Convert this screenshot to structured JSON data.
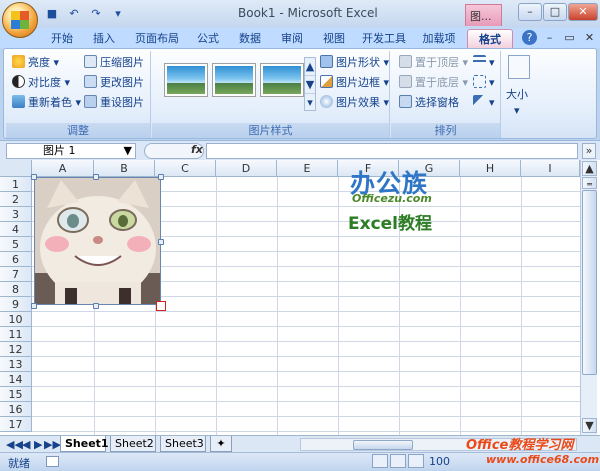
{
  "window": {
    "title": "Book1 - Microsoft Excel",
    "context_title": "图...",
    "controls": [
      "–",
      "□",
      "✕"
    ]
  },
  "qat": [
    "save-icon",
    "undo-icon",
    "redo-icon",
    "customize-icon"
  ],
  "tabs": [
    "开始",
    "插入",
    "页面布局",
    "公式",
    "数据",
    "审阅",
    "视图",
    "开发工具",
    "加载项",
    "格式"
  ],
  "active_tab": "格式",
  "ribbon": {
    "adjust": {
      "label": "调整",
      "items": [
        "亮度",
        "对比度",
        "重新着色",
        "压缩图片",
        "更改图片",
        "重设图片"
      ]
    },
    "styles": {
      "label": "图片样式",
      "items": [
        "图片形状",
        "图片边框",
        "图片效果"
      ]
    },
    "arrange": {
      "label": "排列",
      "items": [
        "置于顶层",
        "置于底层",
        "选择窗格"
      ]
    },
    "size": {
      "label": "大小"
    }
  },
  "formula": {
    "name_box": "图片 1",
    "fx": "fx",
    "value": ""
  },
  "columns": [
    "A",
    "B",
    "C",
    "D",
    "E",
    "F",
    "G",
    "H",
    "I"
  ],
  "rows": [
    "1",
    "2",
    "3",
    "4",
    "5",
    "6",
    "7",
    "8",
    "9",
    "10",
    "11",
    "12",
    "13",
    "14",
    "15",
    "16",
    "17"
  ],
  "overlay_logo": {
    "line1": "办公族",
    "line2": "Officezu.com",
    "line3": "Excel教程"
  },
  "sheets": [
    "Sheet1",
    "Sheet2",
    "Sheet3"
  ],
  "active_sheet": "Sheet1",
  "status": {
    "ready": "就绪",
    "zoom": "100"
  },
  "watermark": {
    "line1": "Office教程学习网",
    "line2": "www.office68.com"
  },
  "colors": {
    "accent": "#15428b",
    "ribbon_bg": "#dbe7f6",
    "context_tab": "#e79bb8"
  }
}
